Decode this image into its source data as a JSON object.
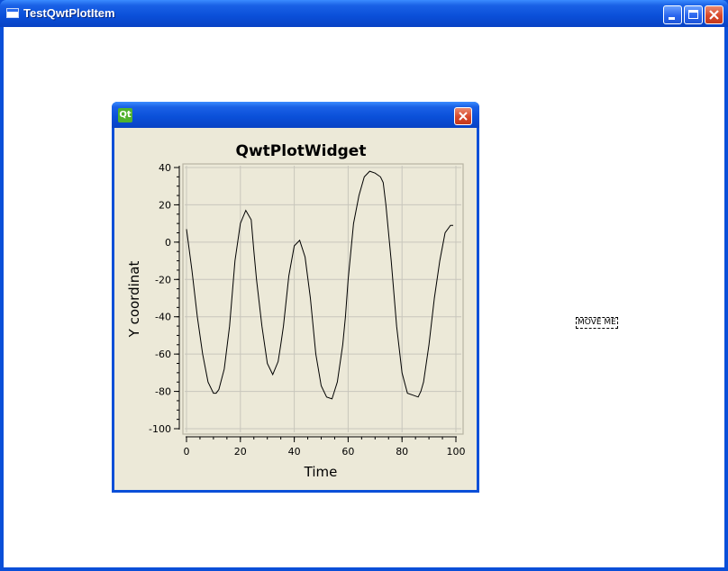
{
  "window": {
    "title": "TestQwtPlotItem"
  },
  "plot_window": {
    "icon_text": "Qt"
  },
  "move_me_label": "MOVE ME",
  "chart_data": {
    "type": "line",
    "title": "QwtPlotWidget",
    "xlabel": "Time",
    "ylabel": "Y coordinat",
    "xlim": [
      0,
      100
    ],
    "ylim": [
      -100,
      40
    ],
    "x_ticks": [
      0,
      20,
      40,
      60,
      80,
      100
    ],
    "y_ticks": [
      40,
      20,
      0,
      -20,
      -40,
      -60,
      -80,
      -100
    ],
    "grid": true,
    "line_color": "#000000",
    "grid_color": "#c8c6bc",
    "series": [
      {
        "x": [
          0,
          2,
          4,
          6,
          8,
          10,
          11,
          12,
          14,
          16,
          18,
          20,
          22,
          24,
          25,
          26,
          28,
          30,
          32,
          34,
          35,
          36,
          38,
          40,
          42,
          44,
          46,
          48,
          50,
          52,
          54,
          56,
          58,
          59,
          60,
          62,
          64,
          66,
          68,
          70,
          72,
          73,
          74,
          76,
          78,
          80,
          82,
          84,
          86,
          87,
          88,
          90,
          92,
          94,
          96,
          98,
          99
        ],
        "y": [
          7,
          -15,
          -40,
          -60,
          -75,
          -81,
          -81,
          -79,
          -68,
          -45,
          -10,
          10,
          17,
          12,
          -5,
          -20,
          -45,
          -65,
          -71,
          -64,
          -55,
          -45,
          -18,
          -2,
          1,
          -8,
          -30,
          -60,
          -77,
          -83,
          -84,
          -75,
          -55,
          -40,
          -20,
          10,
          25,
          35,
          38,
          37,
          35,
          32,
          20,
          -10,
          -45,
          -70,
          -81,
          -82,
          -83,
          -80,
          -75,
          -55,
          -30,
          -10,
          5,
          9,
          9
        ]
      }
    ]
  }
}
